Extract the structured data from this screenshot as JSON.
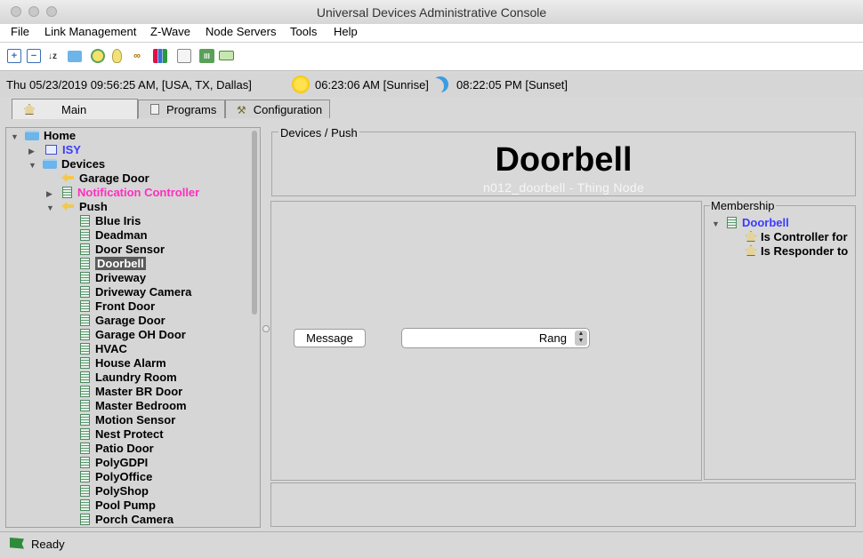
{
  "window": {
    "title": "Universal Devices Administrative Console"
  },
  "menu": [
    "File",
    "Link Management",
    "Z-Wave",
    "Node Servers",
    "Tools",
    "Help"
  ],
  "toolbar_icons": [
    "expand-all-icon",
    "collapse-all-icon",
    "sort-az-icon",
    "folder-icon",
    "network-icon",
    "lightbulb-icon",
    "link-icon",
    "chart-icon",
    "notes-icon",
    "meter-icon",
    "battery-icon"
  ],
  "info": {
    "datetime": "Thu 05/23/2019 09:56:25 AM,  [USA, TX, Dallas]",
    "sunrise": "06:23:06 AM [Sunrise]",
    "sunset": "08:22:05 PM [Sunset]"
  },
  "tabs": [
    "Main",
    "Programs",
    "Configuration"
  ],
  "tree": {
    "home": "Home",
    "isy": "ISY",
    "devices": "Devices",
    "garage_door": "Garage Door",
    "notification_controller": "Notification Controller",
    "push": "Push",
    "push_children": [
      "Blue Iris",
      "Deadman",
      "Door Sensor",
      "Doorbell",
      "Driveway",
      "Driveway Camera",
      "Front Door",
      "Garage Door",
      "Garage OH Door",
      "HVAC",
      "House Alarm",
      "Laundry Room",
      "Master BR Door",
      "Master Bedroom",
      "Motion Sensor",
      "Nest Protect",
      "Patio Door",
      "PolyGDPI",
      "PolyOffice",
      "PolyShop",
      "Pool Pump",
      "Porch Camera"
    ],
    "selected": "Doorbell"
  },
  "node": {
    "breadcrumb": "Devices / Push",
    "title": "Doorbell",
    "subtitle": "n012_doorbell - Thing Node",
    "message_button": "Message",
    "message_value": "Rang"
  },
  "membership": {
    "label": "Membership",
    "node": "Doorbell",
    "controller": "Is Controller for",
    "responder": "Is Responder to"
  },
  "status": {
    "text": "Ready"
  },
  "colors": {
    "isy": "#3b3bff",
    "notification": "#ff2fbf",
    "membership_node": "#3b3bff"
  }
}
